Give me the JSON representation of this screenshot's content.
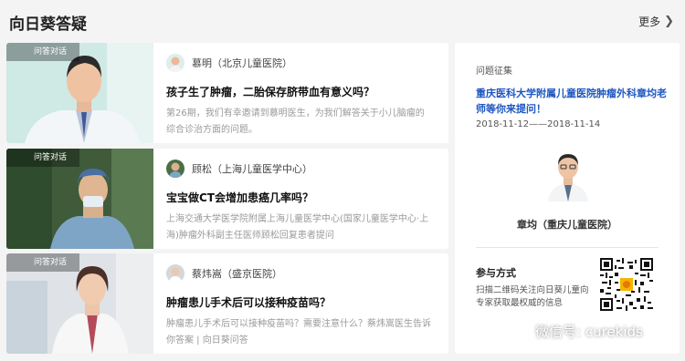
{
  "header": {
    "title": "向日葵答疑",
    "more": "更多"
  },
  "cards": [
    {
      "tag": "问答对话",
      "expert": "慕明（北京儿童医院）",
      "title": "孩子生了肿瘤，二胎保存脐带血有意义吗？",
      "desc": "第26期，我们有幸邀请到慕明医生，为我们解答关于小儿脑瘤的综合诊治方面的问题。"
    },
    {
      "tag": "问答对话",
      "expert": "顾松（上海儿童医学中心）",
      "title": "宝宝做CT会增加患癌几率吗？",
      "desc": "上海交通大学医学院附属上海儿童医学中心(国家儿童医学中心·上海)肿瘤外科副主任医师顾松回复患者提问"
    },
    {
      "tag": "问答对话",
      "expert": "蔡炜嵩（盛京医院）",
      "title": "肿瘤患儿手术后可以接种疫苗吗？",
      "desc": "肿瘤患儿手术后可以接种疫苗吗？需要注意什么？蔡炜嵩医生告诉你答案 | 向日葵问答"
    }
  ],
  "side": {
    "label": "问题征集",
    "title": "重庆医科大学附属儿童医院肿瘤外科章均老师等你来提问！",
    "date": "2018-11-12——2018-11-14",
    "doctor": "章均（重庆儿童医院）",
    "join_title": "参与方式",
    "join_desc": "扫描二维码关注向日葵儿童向专家获取最权威的信息"
  },
  "watermark": "微信号: curekids",
  "colors": {
    "accent": "#1d56c1"
  }
}
